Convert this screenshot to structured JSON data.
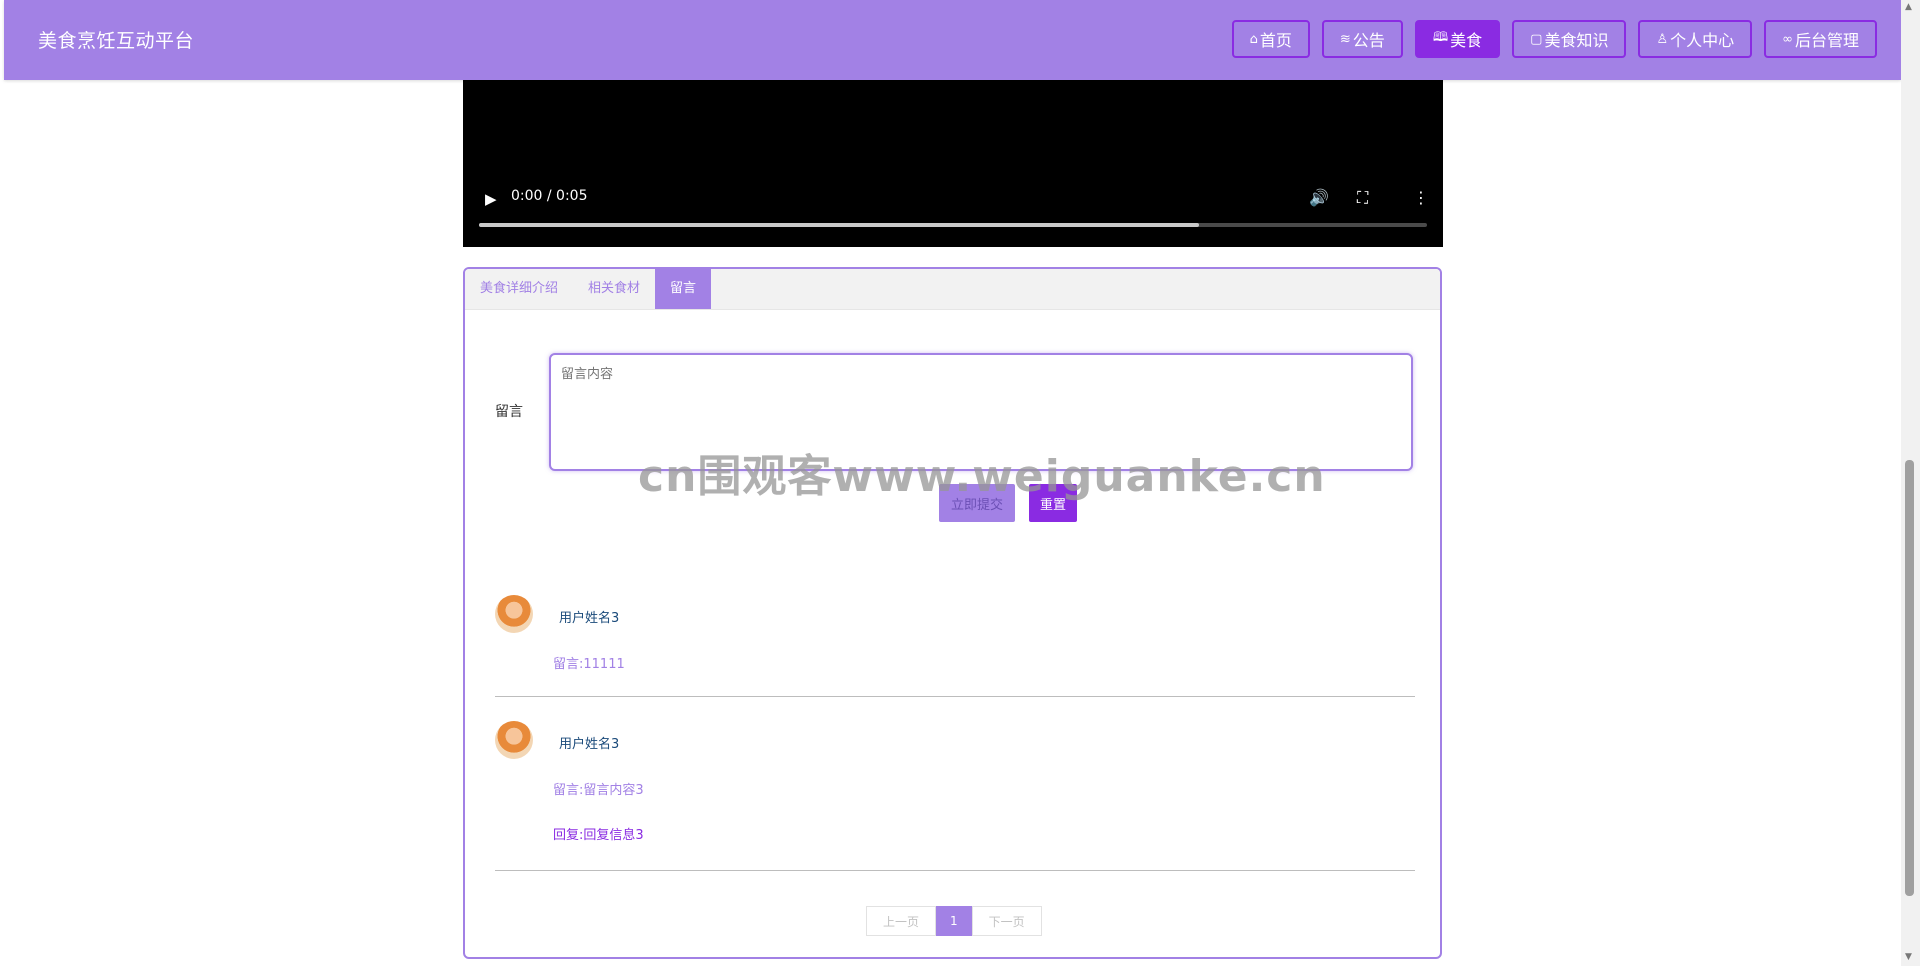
{
  "header": {
    "brand": "美食烹饪互动平台",
    "nav": [
      {
        "icon": "⌂",
        "label": "首页",
        "active": false
      },
      {
        "icon": "≋",
        "label": "公告",
        "active": false
      },
      {
        "icon": "🕮",
        "label": "美食",
        "active": true
      },
      {
        "icon": "▢",
        "label": "美食知识",
        "active": false
      },
      {
        "icon": "♙",
        "label": "个人中心",
        "active": false
      },
      {
        "icon": "∞",
        "label": "后台管理",
        "active": false
      }
    ]
  },
  "video": {
    "time": "0:00 / 0:05",
    "progress": 0.76
  },
  "tabs": [
    "美食详细介绍",
    "相关食材",
    "留言"
  ],
  "form": {
    "label": "留言",
    "placeholder": "留言内容",
    "submit": "立即提交",
    "reset": "重置"
  },
  "messages": [
    {
      "user": "用户姓名3",
      "text": "留言:11111",
      "reply": ""
    },
    {
      "user": "用户姓名3",
      "text": "留言:留言内容3",
      "reply": "回复:回复信息3"
    }
  ],
  "pager": {
    "prev": "上一页",
    "current": "1",
    "next": "下一页"
  },
  "watermark": "cn围观客www.weiguanke.cn"
}
